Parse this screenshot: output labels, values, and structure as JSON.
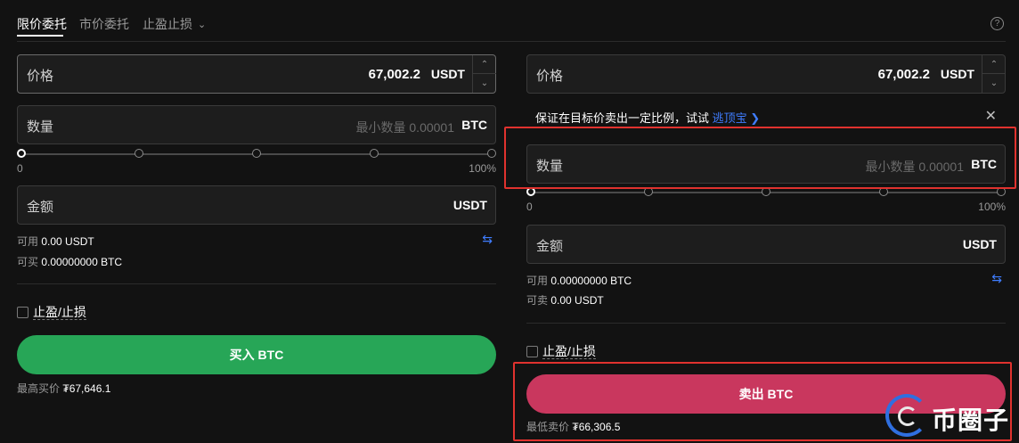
{
  "tabs": {
    "items": [
      {
        "label": "限价委托"
      },
      {
        "label": "市价委托"
      },
      {
        "label": "止盈止损"
      }
    ]
  },
  "buy": {
    "price_label": "价格",
    "price_value": "67,002.2",
    "price_unit": "USDT",
    "qty_label": "数量",
    "qty_placeholder": "最小数量 0.00001",
    "qty_unit": "BTC",
    "slider_min": "0",
    "slider_max": "100%",
    "slider_fraction": 0,
    "amount_label": "金额",
    "amount_unit": "USDT",
    "available_label": "可用",
    "available_value": "0.00 USDT",
    "can_buy_label": "可买",
    "can_buy_value": "0.00000000 BTC",
    "tpsl_label": "止盈/止损",
    "button_label": "买入 BTC",
    "best_label": "最高买价",
    "best_value": "₮67,646.1"
  },
  "sell": {
    "price_label": "价格",
    "price_value": "67,002.2",
    "price_unit": "USDT",
    "banner_text": "保证在目标价卖出一定比例，试试",
    "banner_link": "逃顶宝",
    "banner_link_arrow": "❯",
    "qty_label": "数量",
    "qty_placeholder": "最小数量 0.00001",
    "qty_unit": "BTC",
    "slider_min": "0",
    "slider_max": "100%",
    "slider_fraction": 0,
    "amount_label": "金额",
    "amount_unit": "USDT",
    "available_label": "可用",
    "available_value": "0.00000000 BTC",
    "can_sell_label": "可卖",
    "can_sell_value": "0.00 USDT",
    "tpsl_label": "止盈/止损",
    "button_label": "卖出 BTC",
    "best_label": "最低卖价",
    "best_value": "₮66,306.5"
  },
  "icons": {
    "help": "help-icon",
    "chevron": "chevron-down-icon",
    "swap": "swap-icon",
    "close": "close-icon"
  },
  "colors": {
    "buy": "#27a657",
    "sell": "#c9375e",
    "link": "#3f7dff",
    "highlight": "#e0322e"
  },
  "watermark": {
    "text": "币圈子"
  }
}
